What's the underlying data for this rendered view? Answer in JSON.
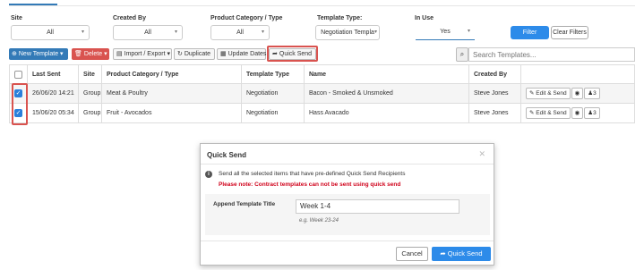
{
  "filters": {
    "site": {
      "label": "Site",
      "value": "All"
    },
    "created_by": {
      "label": "Created By",
      "value": "All"
    },
    "product_category": {
      "label": "Product Category / Type",
      "value": "All"
    },
    "template_type": {
      "label": "Template Type:",
      "value": "Negotiation Templa"
    },
    "in_use": {
      "label": "In Use",
      "value": "Yes"
    },
    "filter_label": "Filter",
    "clear_label": "Clear Filters"
  },
  "toolbar": {
    "new_template": "New Template",
    "delete": "Delete",
    "import_export": "Import / Export",
    "duplicate": "Duplicate",
    "update_dates": "Update Dates",
    "quick_send": "Quick Send",
    "search_placeholder": "Search Templates..."
  },
  "table": {
    "headers": [
      "Last Sent",
      "Site",
      "Product Category / Type",
      "Template Type",
      "Name",
      "Created By"
    ],
    "rows": [
      {
        "last_sent": "26/06/20 14:21",
        "site": "Group",
        "category": "Meat & Poultry",
        "type": "Negotiation",
        "name": "Bacon - Smoked & Unsmoked",
        "created_by": "Steve Jones"
      },
      {
        "last_sent": "15/06/20 05:34",
        "site": "Group",
        "category": "Fruit - Avocados",
        "type": "Negotiation",
        "name": "Hass Avacado",
        "created_by": "Steve Jones"
      }
    ],
    "edit_send": "Edit & Send",
    "people_count": "3"
  },
  "modal": {
    "title": "Quick Send",
    "info": "Send all the selected items that have pre-defined Quick Send Recipients",
    "warning": "Please note: Contract templates can not be sent using quick send",
    "field_label": "Append Template Title",
    "field_value": "Week 1-4",
    "hint": "e.g. Week 23-24",
    "cancel": "Cancel",
    "submit": "Quick Send"
  },
  "colors": {
    "primary": "#337ab7",
    "danger": "#d9534f",
    "action": "#2d8be9"
  }
}
